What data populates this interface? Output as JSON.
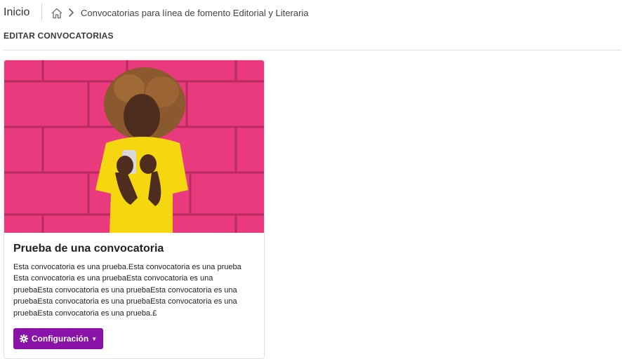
{
  "header": {
    "home_label": "Inicio",
    "breadcrumb": "Convocatorias para línea de fomento Editorial y Literaria"
  },
  "section": {
    "title": "EDITAR CONVOCATORIAS"
  },
  "card": {
    "title": "Prueba de una convocatoria",
    "description": "Esta convocatoria es una prueba.Esta convocatoria es una prueba Esta convocatoria es una pruebaEsta convocatoria es una pruebaEsta convocatoria es una pruebaEsta convocatoria es una pruebaEsta convocatoria es una pruebaEsta convocatoria es una pruebaEsta convocatoria es una prueba.£",
    "button_label": "Configuración",
    "button_icon": "gear-icon",
    "button_color": "#8b12a8"
  },
  "icons": {
    "home": "home-icon",
    "chevron": "chevron-right-icon"
  }
}
